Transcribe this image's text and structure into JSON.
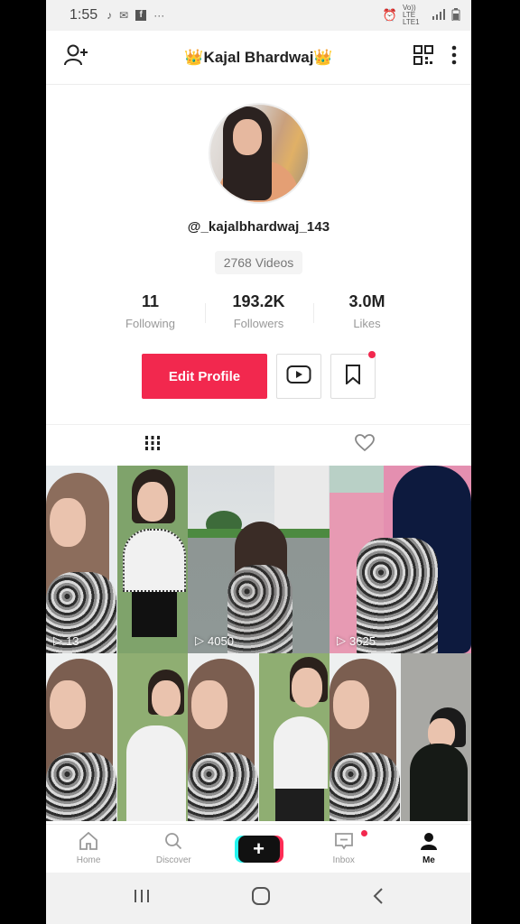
{
  "status_bar": {
    "time": "1:55",
    "left_icons": [
      "tiktok-icon",
      "mail-icon",
      "facebook-icon",
      "more-dots-icon"
    ],
    "right_text": "Vo)) LTE LTE1",
    "right_icons": [
      "alarm-icon",
      "signal-icon",
      "battery-icon"
    ]
  },
  "header": {
    "title": "👑Kajal Bhardwaj👑",
    "left_icon": "add-friend-icon",
    "right_icons": [
      "qr-code-icon",
      "more-vertical-icon"
    ]
  },
  "profile": {
    "username": "@_kajalbhardwaj_143",
    "videos_count": "2768 Videos",
    "stats": [
      {
        "value": "11",
        "label": "Following"
      },
      {
        "value": "193.2K",
        "label": "Followers"
      },
      {
        "value": "3.0M",
        "label": "Likes"
      }
    ],
    "edit_button": "Edit Profile",
    "youtube_icon": "youtube-icon",
    "bookmark_icon": "bookmark-icon"
  },
  "tabs": [
    {
      "icon": "videos-grid-icon",
      "active": true
    },
    {
      "icon": "liked-heart-icon",
      "active": false
    }
  ],
  "videos": [
    {
      "views": "13"
    },
    {
      "views": "4050"
    },
    {
      "views": "3625"
    },
    {
      "views": ""
    },
    {
      "views": ""
    },
    {
      "views": ""
    }
  ],
  "bottom_nav": [
    {
      "label": "Home",
      "icon": "home-icon"
    },
    {
      "label": "Discover",
      "icon": "search-icon"
    },
    {
      "label": "",
      "icon": "create-plus-icon"
    },
    {
      "label": "Inbox",
      "icon": "inbox-icon"
    },
    {
      "label": "Me",
      "icon": "profile-icon"
    }
  ],
  "colors": {
    "accent": "#f2284e",
    "cyan": "#25f4ee",
    "text_dark": "#222222",
    "text_muted": "#999999"
  }
}
